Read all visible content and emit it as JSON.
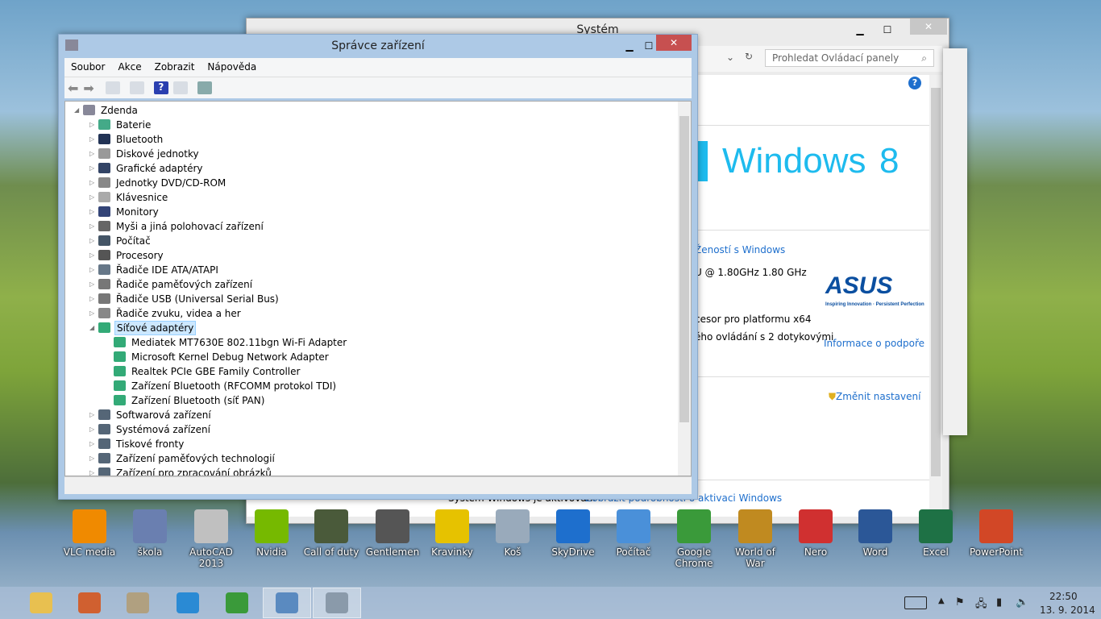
{
  "system_window": {
    "title": "Systém",
    "search_placeholder": "Prohledat Ovládací panely",
    "windows_logo": "Windows",
    "windows_version": "8",
    "rating_link": "Žeností s Windows",
    "cpu_text": "U @ 1.80GHz   1.80 GHz",
    "system_type": "cesor pro platformu x64",
    "touch_text": "ého ovládání s 2 dotykovými",
    "support_link": "Informace o podpoře",
    "change_settings": "Změnit nastavení",
    "activation_text": "Systém Windows je aktivován.",
    "activation_link": "Zobrazit podrobnosti o aktivaci Windows",
    "oem_logo": "ASUS",
    "oem_tagline": "Inspiring Innovation · Persistent Perfection"
  },
  "device_manager": {
    "title": "Správce zařízení",
    "menu": [
      "Soubor",
      "Akce",
      "Zobrazit",
      "Nápověda"
    ],
    "root": "Zdenda",
    "categories": [
      "Baterie",
      "Bluetooth",
      "Diskové jednotky",
      "Grafické adaptéry",
      "Jednotky DVD/CD-ROM",
      "Klávesnice",
      "Monitory",
      "Myši a jiná polohovací zařízení",
      "Počítač",
      "Procesory",
      "Řadiče IDE ATA/ATAPI",
      "Řadiče paměťových zařízení",
      "Řadiče USB (Universal Serial Bus)",
      "Řadiče zvuku, videa a her",
      "Síťové adaptéry"
    ],
    "network_adapters": [
      "Mediatek MT7630E 802.11bgn Wi-Fi Adapter",
      "Microsoft Kernel Debug Network Adapter",
      "Realtek PCIe GBE Family Controller",
      "Zařízení Bluetooth (RFCOMM protokol TDI)",
      "Zařízení Bluetooth (síť PAN)"
    ],
    "categories_after": [
      "Softwarová zařízení",
      "Systémová zařízení",
      "Tiskové fronty",
      "Zařízení paměťových technologií",
      "Zařízení pro zpracování obrázků"
    ]
  },
  "desktop_icons": [
    {
      "label": "VLC media",
      "color": "#f08a00"
    },
    {
      "label": "škola",
      "color": "#6a7fb0"
    },
    {
      "label": "AutoCAD 2013",
      "color": "#c0c0c0"
    },
    {
      "label": "Nvidia",
      "color": "#76b900"
    },
    {
      "label": "Call of duty",
      "color": "#4a5a3a"
    },
    {
      "label": "Gentlemen",
      "color": "#555"
    },
    {
      "label": "Kravinky",
      "color": "#e6c200"
    },
    {
      "label": "Koš",
      "color": "#9ab"
    },
    {
      "label": "SkyDrive",
      "color": "#1e6fcd"
    },
    {
      "label": "Počítač",
      "color": "#4a90d9"
    },
    {
      "label": "Google Chrome",
      "color": "#3a9a3a"
    },
    {
      "label": "World of War",
      "color": "#c08a20"
    },
    {
      "label": "Nero",
      "color": "#d03030"
    },
    {
      "label": "Word",
      "color": "#2b5797"
    },
    {
      "label": "Excel",
      "color": "#1e7145"
    },
    {
      "label": "PowerPoint",
      "color": "#d24726"
    }
  ],
  "taskbar": {
    "apps": [
      {
        "name": "file-explorer",
        "color": "#e8c050"
      },
      {
        "name": "media",
        "color": "#d06030"
      },
      {
        "name": "tool",
        "color": "#b0a080"
      },
      {
        "name": "internet-explorer",
        "color": "#2a8ad4"
      },
      {
        "name": "chrome",
        "color": "#3a9a3a"
      },
      {
        "name": "control-panel",
        "color": "#5a8ac0"
      },
      {
        "name": "device-manager",
        "color": "#8a9aaa"
      }
    ],
    "time": "22:50",
    "date": "13. 9. 2014"
  }
}
